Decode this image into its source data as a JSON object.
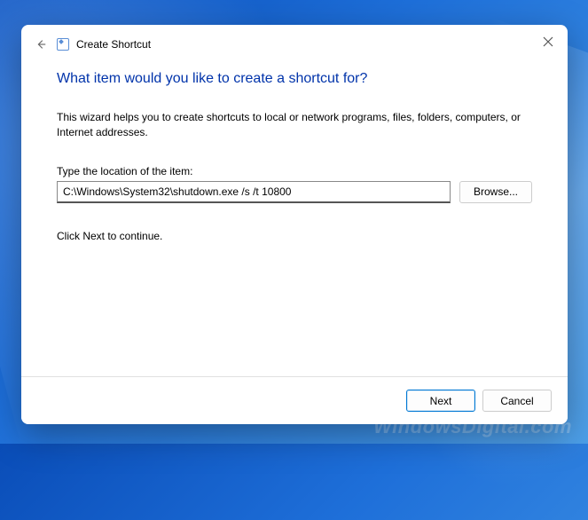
{
  "dialog": {
    "title": "Create Shortcut",
    "heading": "What item would you like to create a shortcut for?",
    "description": "This wizard helps you to create shortcuts to local or network programs, files, folders, computers, or Internet addresses.",
    "field_label": "Type the location of the item:",
    "location_value": "C:\\Windows\\System32\\shutdown.exe /s /t 10800",
    "browse_label": "Browse...",
    "continue_text": "Click Next to continue.",
    "next_label": "Next",
    "cancel_label": "Cancel"
  },
  "watermark": "WindowsDigital.com"
}
